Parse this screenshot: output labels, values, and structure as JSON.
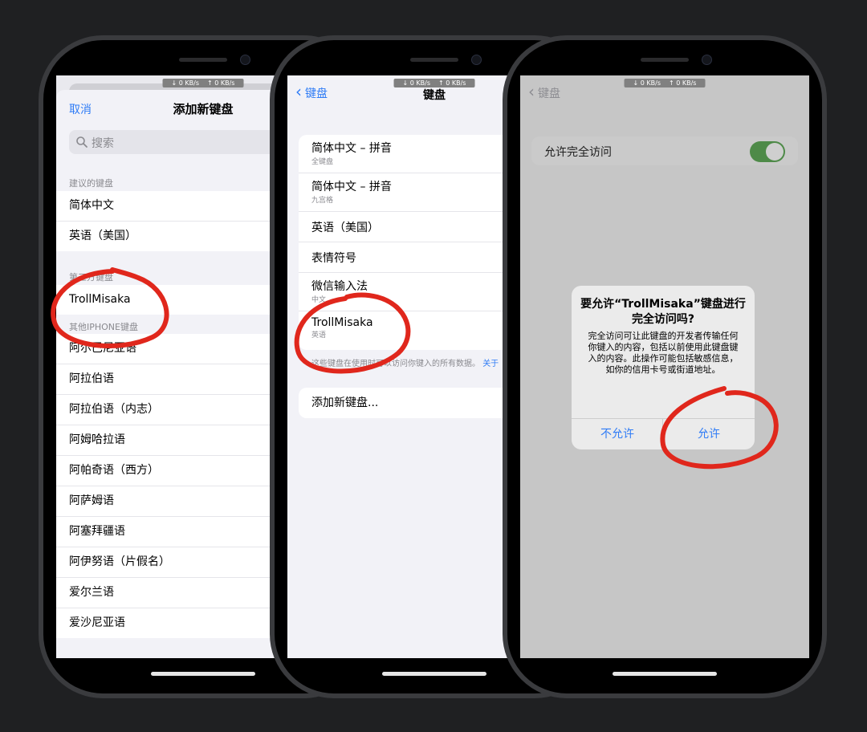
{
  "netspeed": {
    "down": "↓ 0 KB/s",
    "up": "↑ 0 KB/s"
  },
  "screen1": {
    "cancel": "取消",
    "title": "添加新键盘",
    "search_placeholder": "搜索",
    "suggested_header": "建议的键盘",
    "suggested": [
      "简体中文",
      "英语（美国）"
    ],
    "third_party_header": "第三方键盘",
    "third_party": [
      "TrollMisaka"
    ],
    "other_header": "其他IPHONE键盘",
    "other": [
      "阿尔巴尼亚语",
      "阿拉伯语",
      "阿拉伯语（内志）",
      "阿姆哈拉语",
      "阿帕奇语（西方）",
      "阿萨姆语",
      "阿塞拜疆语",
      "阿伊努语（片假名）",
      "爱尔兰语",
      "爱沙尼亚语"
    ]
  },
  "screen2": {
    "back": "键盘",
    "title": "键盘",
    "keyboards": [
      {
        "title": "简体中文 – 拼音",
        "subtitle": "全键盘"
      },
      {
        "title": "简体中文 – 拼音",
        "subtitle": "九宫格"
      },
      {
        "title": "英语（美国）",
        "subtitle": ""
      },
      {
        "title": "表情符号",
        "subtitle": ""
      },
      {
        "title": "微信输入法",
        "subtitle": "中文"
      },
      {
        "title": "TrollMisaka",
        "subtitle": "英语"
      }
    ],
    "footnote": "这些键盘在使用时可以访问你键入的所有数据。",
    "footnote_link": "关于",
    "add_keyboard": "添加新键盘..."
  },
  "screen3": {
    "back": "键盘",
    "toggle_label": "允许完全访问",
    "toggle_on": true,
    "alert_title": "要允许“TrollMisaka”键盘进行完全访问吗?",
    "alert_message": "完全访问可让此键盘的开发者传输任何你键入的内容，包括以前使用此键盘键入的内容。此操作可能包括敏感信息，如你的信用卡号或街道地址。",
    "deny": "不允许",
    "allow": "允许"
  },
  "colors": {
    "accent": "#2f7cf6",
    "annotation": "#e0271c",
    "toggle_on": "#4e8a48"
  }
}
